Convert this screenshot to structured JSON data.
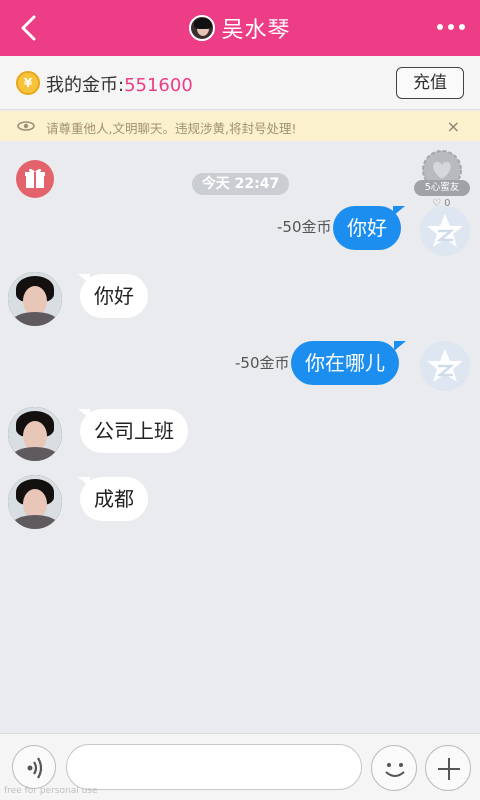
{
  "header": {
    "title": "吴水琴",
    "colors": {
      "bar": "#ed3d86"
    }
  },
  "coins": {
    "icon_char": "¥",
    "label": "我的金币:",
    "value": "551600",
    "recharge_label": "充值"
  },
  "notice": {
    "text": "请尊重他人,文明聊天。违规涉黄,将封号处理!",
    "close_glyph": "×"
  },
  "chat": {
    "timestamp": "今天 22:47",
    "badge": {
      "label": "5心蜜友",
      "heart": "♡",
      "count": "0"
    },
    "messages": [
      {
        "side": "right",
        "text": "你好",
        "cost": "-50金币"
      },
      {
        "side": "left",
        "text": "你好"
      },
      {
        "side": "right",
        "text": "你在哪儿",
        "cost": "-50金币"
      },
      {
        "side": "left",
        "text": "公司上班"
      },
      {
        "side": "left",
        "text": "成都"
      }
    ]
  },
  "input": {
    "value": "",
    "placeholder": ""
  },
  "watermark": "free for personal use",
  "colors": {
    "accent": "#ed3d86",
    "bubble_self": "#1b8ef0",
    "gift": "#e4626b"
  }
}
